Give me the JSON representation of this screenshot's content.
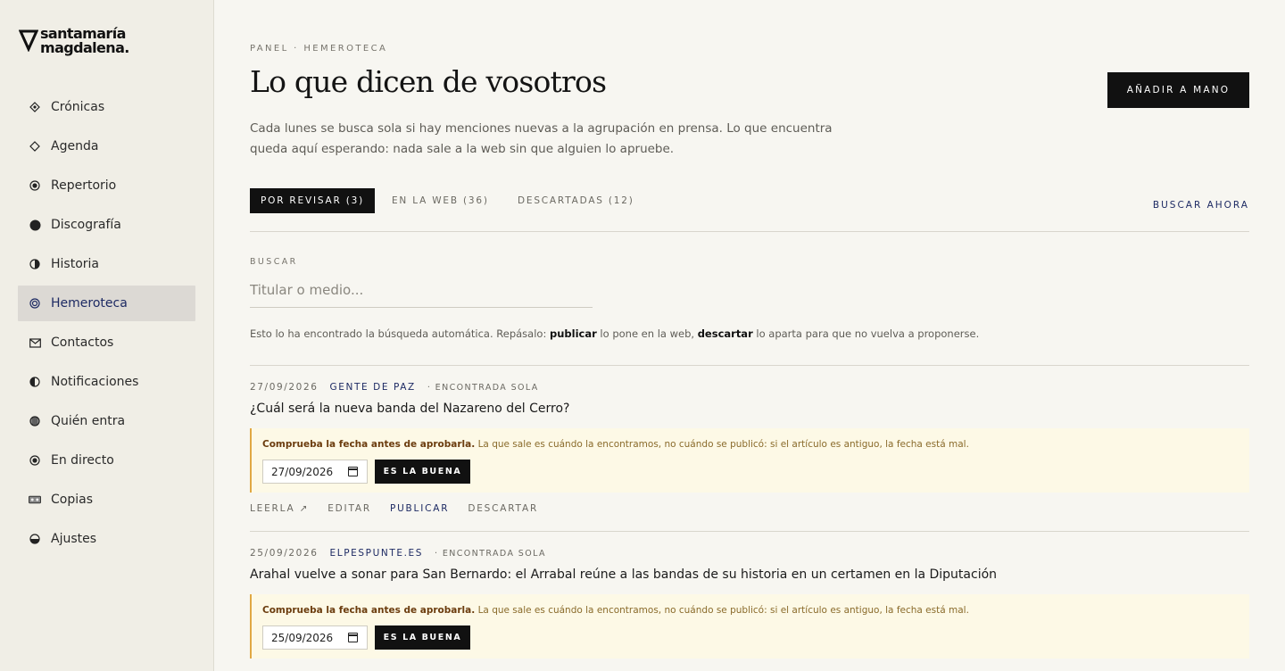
{
  "brand": {
    "line1": "santamaría",
    "line2": "magdalena."
  },
  "sidebar": {
    "items": [
      {
        "label": "Crónicas",
        "icon": "diamond-dot-icon"
      },
      {
        "label": "Agenda",
        "icon": "diamond-outline-icon"
      },
      {
        "label": "Repertorio",
        "icon": "target-icon"
      },
      {
        "label": "Discografía",
        "icon": "filled-circle-icon"
      },
      {
        "label": "Historia",
        "icon": "half-circle-icon"
      },
      {
        "label": "Hemeroteca",
        "icon": "concentric-circle-icon",
        "active": true
      },
      {
        "label": "Contactos",
        "icon": "envelope-icon"
      },
      {
        "label": "Notificaciones",
        "icon": "half-circle-left-icon"
      },
      {
        "label": "Quién entra",
        "icon": "striped-circle-icon"
      },
      {
        "label": "En directo",
        "icon": "target-icon"
      },
      {
        "label": "Copias",
        "icon": "tape-icon"
      },
      {
        "label": "Ajustes",
        "icon": "half-circle-bottom-icon"
      }
    ]
  },
  "header": {
    "breadcrumb": "PANEL · HEMEROTECA",
    "title": "Lo que dicen de vosotros",
    "add_button": "AÑADIR A MANO",
    "intro": "Cada lunes se busca sola si hay menciones nuevas a la agrupación en prensa. Lo que encuentra queda aquí esperando: nada sale a la web sin que alguien lo apruebe."
  },
  "tabs": [
    {
      "label": "POR REVISAR (3)",
      "active": true
    },
    {
      "label": "EN LA WEB (36)"
    },
    {
      "label": "DESCARTADAS (12)"
    }
  ],
  "search_now": "BUSCAR AHORA",
  "search": {
    "label": "BUSCAR",
    "placeholder": "Titular o medio..."
  },
  "hint": {
    "part1": "Esto lo ha encontrado la búsqueda automática. Repásalo: ",
    "publish": "publicar",
    "part2": " lo pone en la web, ",
    "discard": "descartar",
    "part3": " lo aparta para que no vuelva a proponerse."
  },
  "warning": {
    "bold": "Comprueba la fecha antes de aprobarla.",
    "text": " La que sale es cuándo la encontramos, no cuándo se publicó: si el artículo es antiguo, la fecha está mal.",
    "button": "ES LA BUENA"
  },
  "actions": {
    "read": "LEERLA ↗",
    "edit": "EDITAR",
    "publish": "PUBLICAR",
    "discard": "DESCARTAR"
  },
  "entries": [
    {
      "date": "27/09/2026",
      "source": "GENTE DE PAZ",
      "found": "· ENCONTRADA SOLA",
      "headline": "¿Cuál será la nueva banda del Nazareno del Cerro?",
      "date_value": "27/09/2026"
    },
    {
      "date": "25/09/2026",
      "source": "ELPESPUNTE.ES",
      "found": "· ENCONTRADA SOLA",
      "headline": "Arahal vuelve a sonar para San Bernardo: el Arrabal reúne a las bandas de su historia en un certamen en la Diputación",
      "date_value": "25/09/2026"
    }
  ]
}
